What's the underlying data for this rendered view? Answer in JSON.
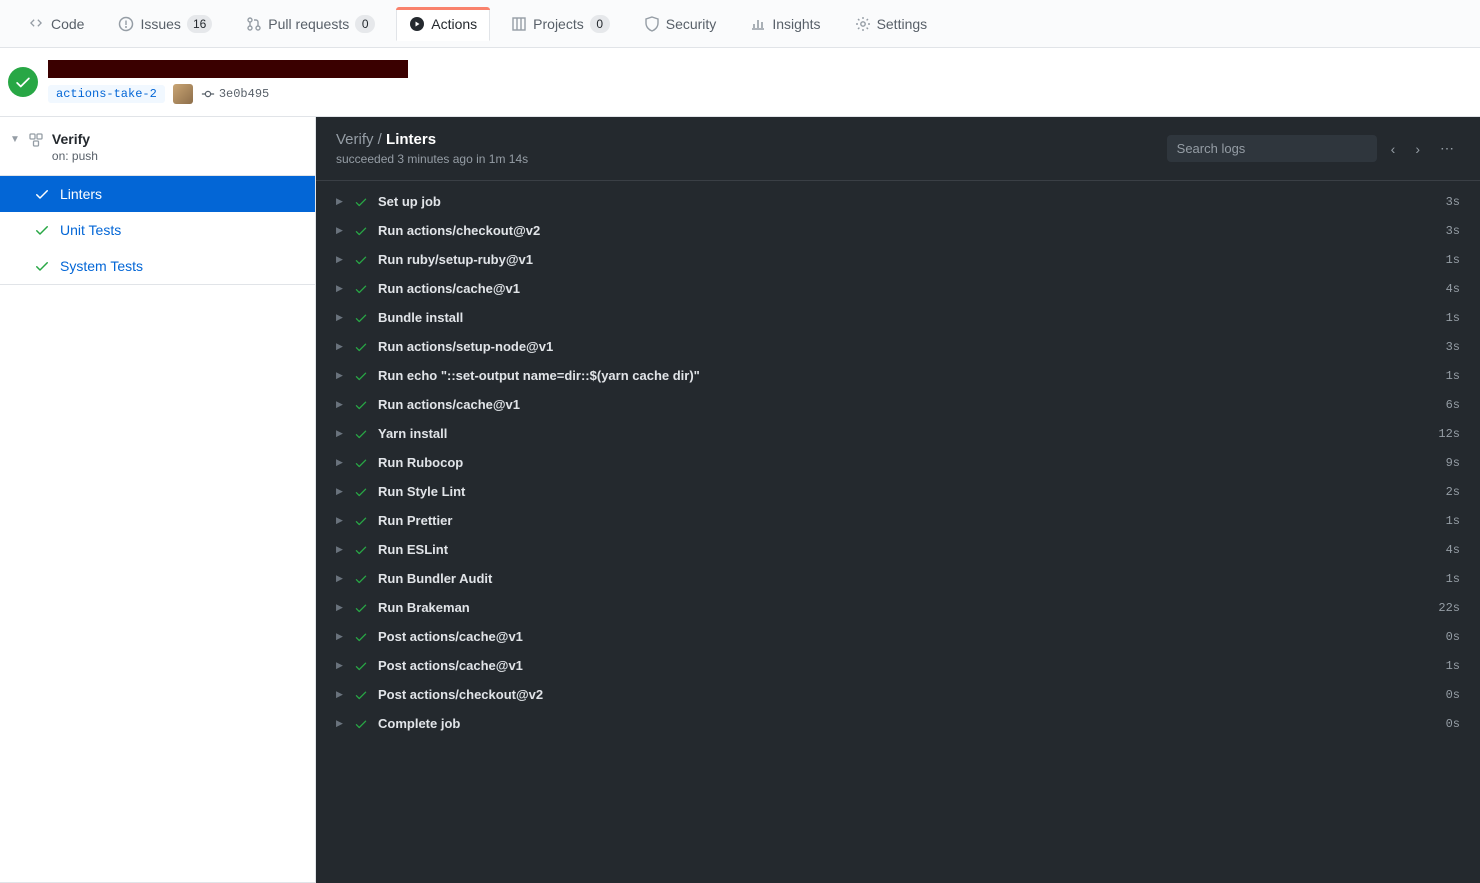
{
  "tabs": [
    {
      "label": "Code",
      "icon": "code",
      "count": null
    },
    {
      "label": "Issues",
      "icon": "issue",
      "count": "16"
    },
    {
      "label": "Pull requests",
      "icon": "pr",
      "count": "0"
    },
    {
      "label": "Actions",
      "icon": "play",
      "count": null,
      "active": true
    },
    {
      "label": "Projects",
      "icon": "project",
      "count": "0"
    },
    {
      "label": "Security",
      "icon": "shield",
      "count": null
    },
    {
      "label": "Insights",
      "icon": "graph",
      "count": null
    },
    {
      "label": "Settings",
      "icon": "gear",
      "count": null
    }
  ],
  "run": {
    "branch": "actions-take-2",
    "commit": "3e0b495"
  },
  "workflow": {
    "name": "Verify",
    "on": "on: push",
    "jobs": [
      {
        "label": "Linters",
        "active": true
      },
      {
        "label": "Unit Tests"
      },
      {
        "label": "System Tests"
      }
    ]
  },
  "log": {
    "breadcrumb": "Verify /",
    "job": "Linters",
    "status": "succeeded 3 minutes ago in 1m 14s",
    "search_placeholder": "Search logs",
    "steps": [
      {
        "name": "Set up job",
        "dur": "3s"
      },
      {
        "name": "Run actions/checkout@v2",
        "dur": "3s"
      },
      {
        "name": "Run ruby/setup-ruby@v1",
        "dur": "1s"
      },
      {
        "name": "Run actions/cache@v1",
        "dur": "4s"
      },
      {
        "name": "Bundle install",
        "dur": "1s"
      },
      {
        "name": "Run actions/setup-node@v1",
        "dur": "3s"
      },
      {
        "name": "Run echo \"::set-output name=dir::$(yarn cache dir)\"",
        "dur": "1s"
      },
      {
        "name": "Run actions/cache@v1",
        "dur": "6s"
      },
      {
        "name": "Yarn install",
        "dur": "12s"
      },
      {
        "name": "Run Rubocop",
        "dur": "9s"
      },
      {
        "name": "Run Style Lint",
        "dur": "2s"
      },
      {
        "name": "Run Prettier",
        "dur": "1s"
      },
      {
        "name": "Run ESLint",
        "dur": "4s"
      },
      {
        "name": "Run Bundler Audit",
        "dur": "1s"
      },
      {
        "name": "Run Brakeman",
        "dur": "22s"
      },
      {
        "name": "Post actions/cache@v1",
        "dur": "0s"
      },
      {
        "name": "Post actions/cache@v1",
        "dur": "1s"
      },
      {
        "name": "Post actions/checkout@v2",
        "dur": "0s"
      },
      {
        "name": "Complete job",
        "dur": "0s"
      }
    ]
  }
}
